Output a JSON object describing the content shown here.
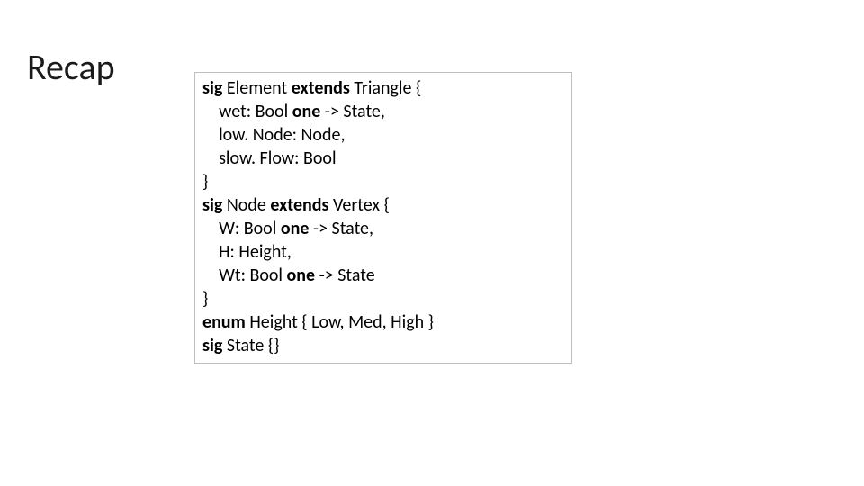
{
  "slide": {
    "title": "Recap"
  },
  "code": {
    "lines": [
      [
        {
          "t": "sig",
          "bold": true
        },
        {
          "t": " Element ",
          "bold": false
        },
        {
          "t": "extends",
          "bold": true
        },
        {
          "t": " Triangle {",
          "bold": false
        }
      ],
      [
        {
          "t": "    wet: Bool ",
          "bold": false
        },
        {
          "t": "one",
          "bold": true
        },
        {
          "t": " -> State,",
          "bold": false
        }
      ],
      [
        {
          "t": "    low. Node: Node,",
          "bold": false
        }
      ],
      [
        {
          "t": "    slow. Flow: Bool",
          "bold": false
        }
      ],
      [
        {
          "t": "}",
          "bold": false
        }
      ],
      [
        {
          "t": "sig",
          "bold": true
        },
        {
          "t": " Node ",
          "bold": false
        },
        {
          "t": "extends",
          "bold": true
        },
        {
          "t": " Vertex {",
          "bold": false
        }
      ],
      [
        {
          "t": "    W: Bool ",
          "bold": false
        },
        {
          "t": "one",
          "bold": true
        },
        {
          "t": " -> State,",
          "bold": false
        }
      ],
      [
        {
          "t": "    H: Height,",
          "bold": false
        }
      ],
      [
        {
          "t": "    Wt: Bool ",
          "bold": false
        },
        {
          "t": "one",
          "bold": true
        },
        {
          "t": " -> State",
          "bold": false
        }
      ],
      [
        {
          "t": "}",
          "bold": false
        }
      ],
      [
        {
          "t": "enum",
          "bold": true
        },
        {
          "t": " Height { Low, Med, High }",
          "bold": false
        }
      ],
      [
        {
          "t": "sig",
          "bold": true
        },
        {
          "t": " State {}",
          "bold": false
        }
      ]
    ]
  }
}
